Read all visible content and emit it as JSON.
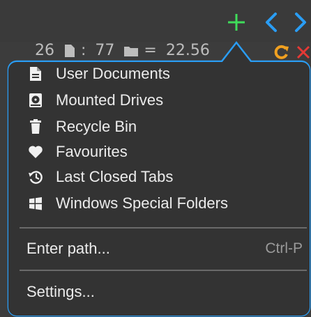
{
  "toolbar": {
    "add_icon": "plus-icon",
    "prev_icon": "chevron-left-icon",
    "next_icon": "chevron-right-icon",
    "accent_green": "#3fdc5a",
    "accent_blue": "#2a9df4"
  },
  "status": {
    "files_count": "26",
    "selected_count": "77",
    "size_text": "22.56"
  },
  "menu": {
    "items": [
      {
        "label": "User Documents",
        "icon": "document-icon"
      },
      {
        "label": "Mounted Drives",
        "icon": "hard-drive-icon"
      },
      {
        "label": "Recycle Bin",
        "icon": "trash-icon"
      },
      {
        "label": "Favourites",
        "icon": "heart-icon"
      },
      {
        "label": "Last Closed Tabs",
        "icon": "history-icon"
      },
      {
        "label": "Windows Special Folders",
        "icon": "windows-icon"
      }
    ],
    "enter_path": {
      "label": "Enter path...",
      "shortcut": "Ctrl-P"
    },
    "settings": {
      "label": "Settings..."
    },
    "border_color": "#2a9df4"
  }
}
